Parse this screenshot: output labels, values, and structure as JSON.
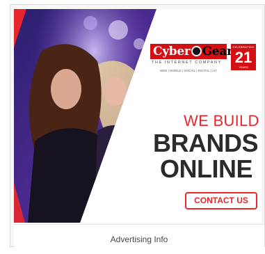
{
  "ad": {
    "logo": {
      "name_part1": "Cyber",
      "name_part2": "Gear",
      "tagline": "THE INTERNET COMPANY",
      "services": "WEB | MOBILE | SOCIAL | DIGITAL | IoT"
    },
    "badge": {
      "celebrating": "CELEBRATING",
      "number": "21",
      "years": "YEARS"
    },
    "headline": {
      "line1": "WE BUILD",
      "line2": "BRANDS",
      "line3": "ONLINE"
    },
    "cta_label": "CONTACT US",
    "colors": {
      "accent": "#e8262c",
      "dark_text": "#2b2b2b",
      "logo_red": "#d40f14"
    }
  },
  "footer": {
    "label": "Advertising Info"
  }
}
